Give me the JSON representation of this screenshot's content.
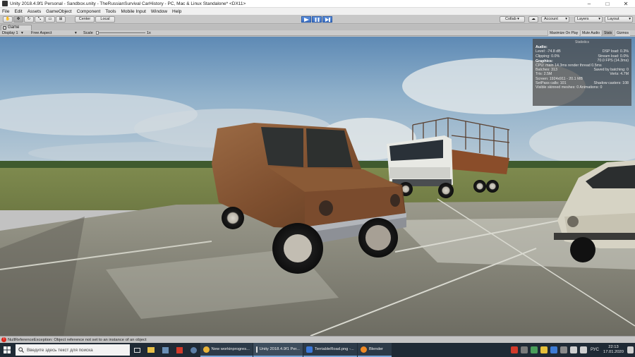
{
  "window": {
    "title": "Unity 2018.4.9f1 Personal - Sandbox.unity - TheRussianSurvival CarHistory - PC, Mac & Linux Standalone* <DX11>",
    "controls": [
      "minimize",
      "maximize",
      "close"
    ]
  },
  "menu": [
    "File",
    "Edit",
    "Assets",
    "GameObject",
    "Component",
    "Tools",
    "Mobile Input",
    "Window",
    "Help"
  ],
  "toolbar": {
    "pivot_label": "Center",
    "space_label": "Local",
    "collab_label": "Collab ▾",
    "account_label": "Account",
    "layers_label": "Layers",
    "layout_label": "Layout"
  },
  "game_tab": {
    "label": "Game",
    "display": "Display 1",
    "aspect": "Free Aspect",
    "scale_label": "Scale",
    "scale_value": "1x",
    "scale_level": 0.0,
    "buttons": [
      "Maximize On Play",
      "Mute Audio",
      "Stats",
      "Gizmos"
    ]
  },
  "stats": {
    "header": "Statistics",
    "audio_title": "Audio:",
    "level": "Level: -74.8 dB",
    "dsp": "DSP load: 0.3%",
    "clipping": "Clipping: 0.0%",
    "stream": "Stream load: 0.0%",
    "graphics_title": "Graphics:",
    "fps": "70.0 FPS (14.3ms)",
    "cpu": "CPU: main 14.3ms   render thread 0.5ms",
    "batches": "Batches: 313",
    "saved": "Saved by batching: 0",
    "tris": "Tris: 2.5M",
    "verts": "Verts: 4.7M",
    "screen": "Screen: 1924x911 - 20.1 MB",
    "setpass": "SetPass calls: 101",
    "shadow": "Shadow casters: 108",
    "visible": "Visible skinned meshes: 0  Animations: 0"
  },
  "console": {
    "message": "NullReferenceException: Object reference not set to an instance of an object"
  },
  "taskbar": {
    "search_placeholder": "Введите здесь текст для поиска",
    "apps": [
      {
        "label": "New workinprogres...",
        "color": "#e8b339"
      },
      {
        "label": "Unity 2018.4.9f1 Per...",
        "color": "#dddddd"
      },
      {
        "label": "TerriableRoad.png -...",
        "color": "#3c78d8"
      },
      {
        "label": "Blender",
        "color": "#f08a24"
      }
    ],
    "language": "РУС",
    "time": "22:13",
    "date": "17.01.2020"
  }
}
